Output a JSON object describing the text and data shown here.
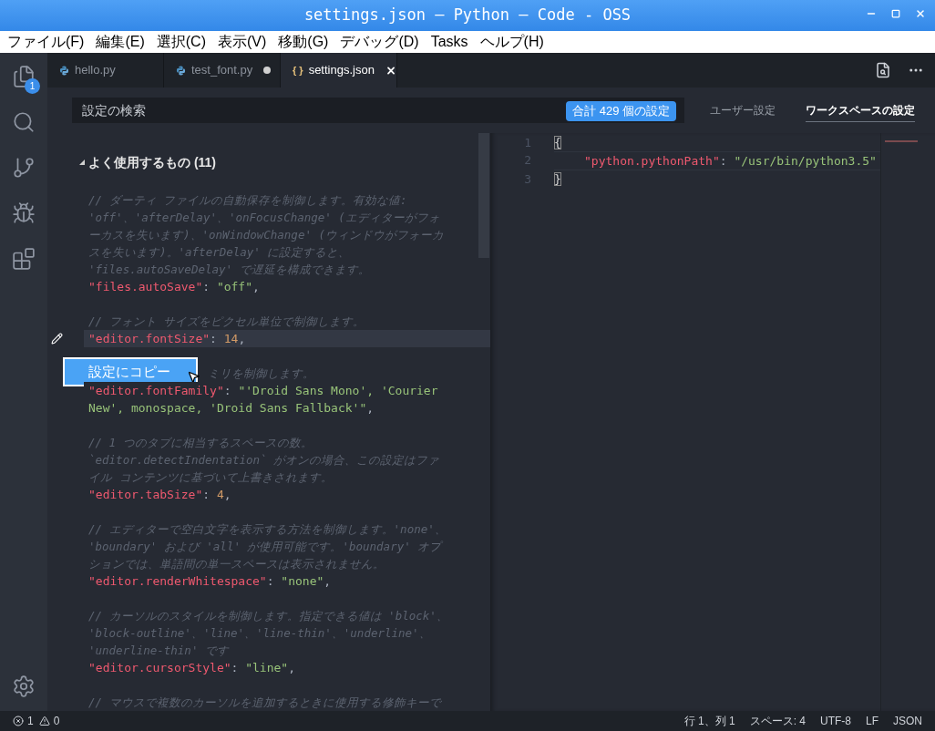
{
  "window": {
    "title": "settings.json — Python — Code - OSS"
  },
  "menu": [
    "ファイル(F)",
    "編集(E)",
    "選択(C)",
    "表示(V)",
    "移動(G)",
    "デバッグ(D)",
    "Tasks",
    "ヘルプ(H)"
  ],
  "activity_bar": {
    "items": [
      {
        "kind": "explorer",
        "badge": "1"
      },
      {
        "kind": "search"
      },
      {
        "kind": "source-control"
      },
      {
        "kind": "debug"
      },
      {
        "kind": "extensions"
      }
    ],
    "bottom": [
      {
        "kind": "settings"
      }
    ]
  },
  "tabs": [
    {
      "label": "hello.py",
      "kind": "python",
      "selected": false,
      "dirty": false
    },
    {
      "label": "test_font.py",
      "kind": "python",
      "selected": false,
      "dirty": true
    },
    {
      "label": "settings.json",
      "kind": "json",
      "icon_text": "{ }",
      "selected": true,
      "dirty": false
    }
  ],
  "settings_header": {
    "search_placeholder": "設定の検索",
    "count_badge": "合計 429 個の設定",
    "targets": [
      {
        "label": "ユーザー設定",
        "selected": false
      },
      {
        "label": "ワークスペースの設定",
        "selected": true
      }
    ]
  },
  "default_settings": {
    "group": {
      "title": "よく使用するもの (11)",
      "expanded": true
    },
    "entries": [
      {
        "comment": [
          "// ダーティ ファイルの自動保存を制御します。有効な値:",
          "'off'、'afterDelay'、'onFocusChange' (エディターがフォ",
          "ーカスを失います)、'onWindowChange' (ウィンドウがフォーカ",
          "スを失います)。'afterDelay' に設定すると、",
          "'files.autoSaveDelay' で遅延を構成できます。"
        ],
        "highlighted": false,
        "tokens": [
          {
            "t": "\"files.autoSave\"",
            "kind": "key"
          },
          {
            "t": ": ",
            "kind": "punct"
          },
          {
            "t": "\"off\"",
            "kind": "string"
          },
          {
            "t": ",",
            "kind": "punct"
          }
        ]
      },
      {
        "comment": [
          "// フォント サイズをピクセル単位で制御します。"
        ],
        "highlighted": true,
        "tokens": [
          {
            "t": "\"editor.fontSize\"",
            "kind": "key"
          },
          {
            "t": ": ",
            "kind": "punct"
          },
          {
            "t": "14",
            "kind": "number"
          },
          {
            "t": ",",
            "kind": "punct"
          }
        ]
      },
      {
        "comment": [
          "ミリを制御します。"
        ],
        "context_menu": {
          "items": [
            {
              "label": "設定にコピー",
              "selected": true
            }
          ]
        },
        "highlighted": false,
        "tokens": [
          {
            "t": "\"editor.fontFamily\"",
            "kind": "key"
          },
          {
            "t": ": ",
            "kind": "punct"
          },
          {
            "t": "\"'Droid Sans Mono', 'Courier New', monospace, 'Droid Sans Fallback'\"",
            "kind": "string"
          },
          {
            "t": ",",
            "kind": "punct"
          }
        ]
      },
      {
        "comment": [
          "// 1 つのタブに相当するスペースの数。",
          "`editor.detectIndentation` がオンの場合、この設定はファ",
          "イル コンテンツに基づいて上書きされます。"
        ],
        "highlighted": false,
        "tokens": [
          {
            "t": "\"editor.tabSize\"",
            "kind": "key"
          },
          {
            "t": ": ",
            "kind": "punct"
          },
          {
            "t": "4",
            "kind": "number"
          },
          {
            "t": ",",
            "kind": "punct"
          }
        ]
      },
      {
        "comment": [
          "// エディターで空白文字を表示する方法を制御します。'none'、",
          "'boundary' および 'all' が使用可能です。'boundary' オプ",
          "ションでは、単語間の単一スペースは表示されません。"
        ],
        "highlighted": false,
        "tokens": [
          {
            "t": "\"editor.renderWhitespace\"",
            "kind": "key"
          },
          {
            "t": ": ",
            "kind": "punct"
          },
          {
            "t": "\"none\"",
            "kind": "string"
          },
          {
            "t": ",",
            "kind": "punct"
          }
        ]
      },
      {
        "comment": [
          "// カーソルのスタイルを制御します。指定できる値は 'block'、",
          "'block-outline'、'line'、'line-thin'、'underline'、",
          "'underline-thin' です"
        ],
        "highlighted": false,
        "tokens": [
          {
            "t": "\"editor.cursorStyle\"",
            "kind": "key"
          },
          {
            "t": ": ",
            "kind": "punct"
          },
          {
            "t": "\"line\"",
            "kind": "string"
          },
          {
            "t": ",",
            "kind": "punct"
          }
        ]
      },
      {
        "comment": [
          "// マウスで複数のカーソルを追加するときに使用する修飾キーで"
        ]
      }
    ]
  },
  "editor": {
    "lines": [
      {
        "num": "1",
        "indented": false,
        "current": false,
        "tokens": [
          {
            "t": "{",
            "kind": "bracket",
            "matched": true
          }
        ]
      },
      {
        "num": "2",
        "indented": true,
        "current": true,
        "tokens": [
          {
            "t": "\"python.pythonPath\"",
            "kind": "key"
          },
          {
            "t": ": ",
            "kind": "punct"
          },
          {
            "t": "\"/usr/bin/python3.5\"",
            "kind": "string"
          }
        ]
      },
      {
        "num": "3",
        "indented": false,
        "current": false,
        "tokens": [
          {
            "t": "}",
            "kind": "bracket",
            "matched": true
          }
        ]
      }
    ]
  },
  "status_bar": {
    "errors": "1",
    "warnings": "0",
    "items": [
      "行 1、列 1",
      "スペース: 4",
      "UTF-8",
      "LF",
      "JSON"
    ]
  }
}
